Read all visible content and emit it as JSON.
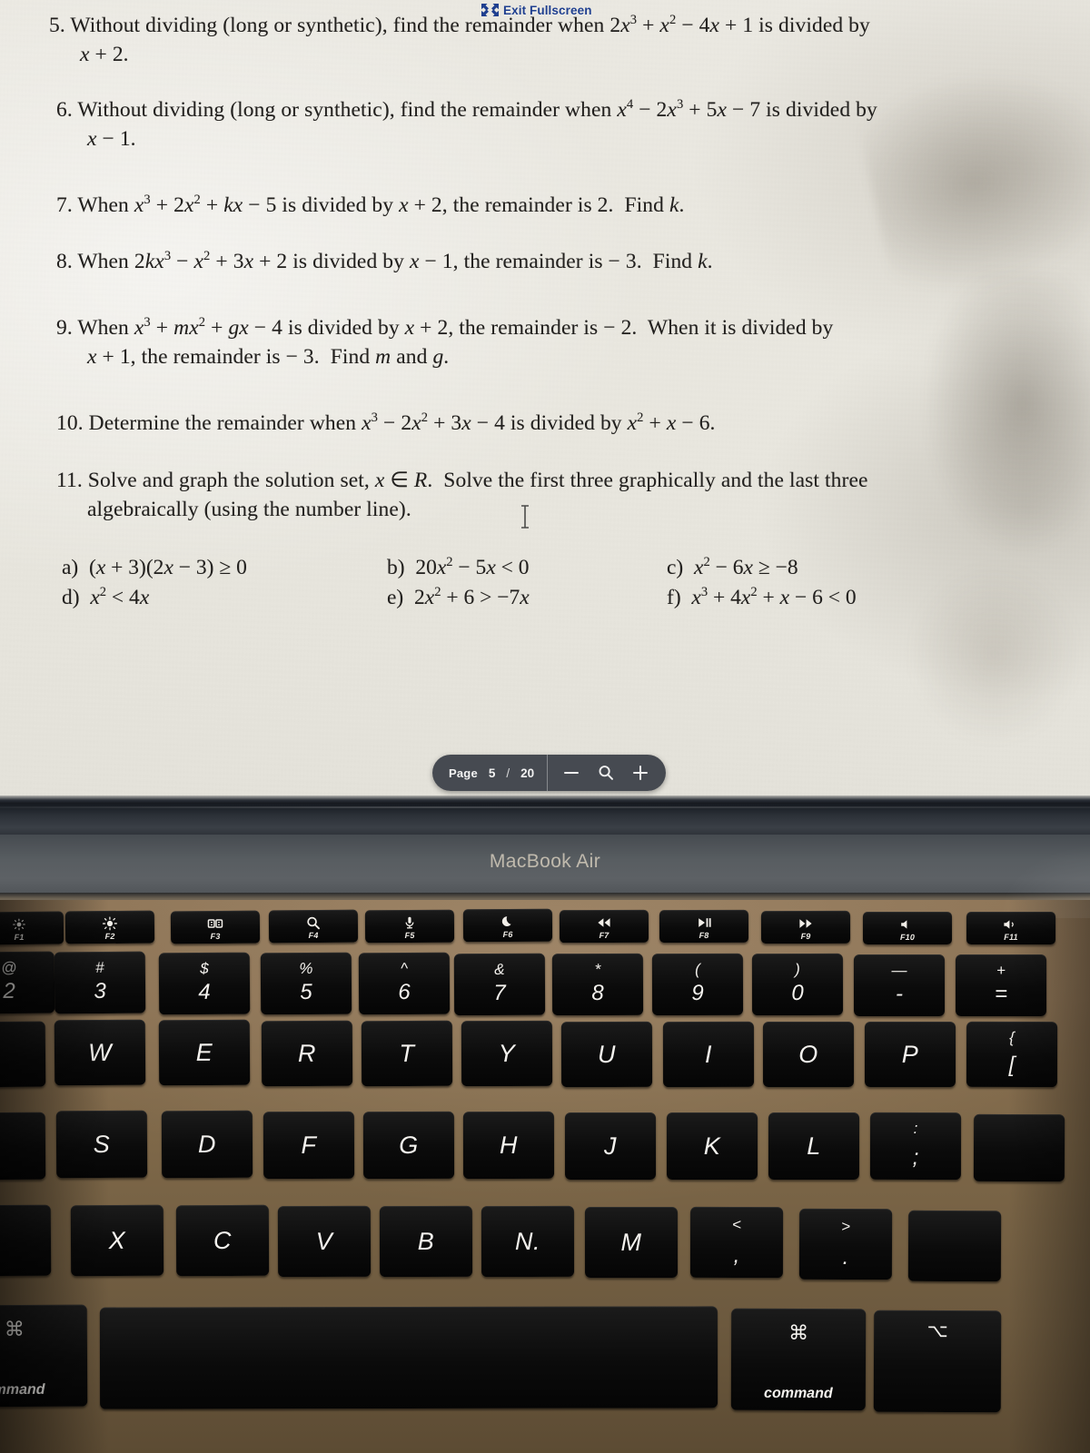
{
  "document": {
    "problems": [
      {
        "id": "p5",
        "number": "5.",
        "line1_pre": "Without dividing (long or synthetic), find the remainder when ",
        "expr1": "2x³ + x² − 4x + 1",
        "line1_post": " is divided by",
        "line2": "x + 2."
      },
      {
        "id": "p6",
        "number": "6.",
        "line1_pre": "Without dividing (long or synthetic), find the remainder when ",
        "expr1": "x⁴ − 2x³ + 5x − 7",
        "line1_post": " is divided by",
        "line2": "x − 1."
      },
      {
        "id": "p7",
        "number": "7.",
        "line1_pre": "When ",
        "expr1": "x³ + 2x² + kx − 5",
        "line1_post": " is divided by x + 2, the remainder is 2.  Find k.",
        "line2": ""
      },
      {
        "id": "p8",
        "number": "8.",
        "line1_pre": "When ",
        "expr1": "2kx³ − x² + 3x + 2",
        "line1_post": " is divided by x − 1, the remainder is − 3.  Find k.",
        "line2": ""
      },
      {
        "id": "p9",
        "number": "9.",
        "line1_pre": "When ",
        "expr1": "x³ + mx² + gx − 4",
        "line1_post": " is divided by x + 2, the remainder is − 2.  When it is divided by",
        "line2": "x + 1, the remainder is − 3.  Find m and g."
      },
      {
        "id": "p10",
        "number": "10.",
        "line1_pre": "Determine the remainder when ",
        "expr1": "x³ − 2x² + 3x − 4",
        "line1_post": " is divided by x² + x − 6.",
        "line2": ""
      },
      {
        "id": "p11",
        "number": "11.",
        "line1_pre": "Solve and graph the solution set, ",
        "expr1": "x ∈ R",
        "line1_post": ".  Solve the first three graphically and the last three",
        "line2": "algebraically (using the number line)."
      }
    ],
    "subproblems": [
      {
        "label": "a)",
        "expr": "(x + 3)(2x − 3) ≥ 0"
      },
      {
        "label": "b)",
        "expr": "20x² − 5x < 0"
      },
      {
        "label": "c)",
        "expr": "x² − 6x ≥ −8"
      },
      {
        "label": "d)",
        "expr": "x² < 4x"
      },
      {
        "label": "e)",
        "expr": "2x² + 6 > −7x"
      },
      {
        "label": "f)",
        "expr": "x³ + 4x² + x − 6 < 0"
      }
    ]
  },
  "overlay": {
    "exit_fullscreen_label": "Exit Fullscreen",
    "exit_fullscreen_icon": "exit-fullscreen-icon",
    "exit_fullscreen_color": "#1f3f8f"
  },
  "pagebar": {
    "page_label": "Page",
    "current_page": "5",
    "separator": "/",
    "total_pages": "20",
    "zoom_out_icon": "minus-icon",
    "zoom_icon": "magnifier-icon",
    "zoom_in_icon": "plus-icon",
    "background": "#3a3e46"
  },
  "laptop": {
    "brand": "MacBook Air",
    "deck_color": "#7d6748",
    "key_color": "#0b0b0b",
    "function_row": [
      {
        "fn": "F1",
        "icon": "brightness-down-icon"
      },
      {
        "fn": "F2",
        "icon": "brightness-up-icon"
      },
      {
        "fn": "F3",
        "icon": "mission-control-icon"
      },
      {
        "fn": "F4",
        "icon": "spotlight-search-icon"
      },
      {
        "fn": "F5",
        "icon": "dictation-mic-icon"
      },
      {
        "fn": "F6",
        "icon": "do-not-disturb-moon-icon"
      },
      {
        "fn": "F7",
        "icon": "rewind-icon"
      },
      {
        "fn": "F8",
        "icon": "play-pause-icon"
      },
      {
        "fn": "F9",
        "icon": "fast-forward-icon"
      },
      {
        "fn": "F10",
        "icon": "mute-icon"
      },
      {
        "fn": "F11",
        "icon": "volume-down-icon"
      }
    ],
    "number_row": [
      {
        "top": "@",
        "bottom": "2"
      },
      {
        "top": "#",
        "bottom": "3"
      },
      {
        "top": "$",
        "bottom": "4"
      },
      {
        "top": "%",
        "bottom": "5"
      },
      {
        "top": "^",
        "bottom": "6"
      },
      {
        "top": "&",
        "bottom": "7"
      },
      {
        "top": "*",
        "bottom": "8"
      },
      {
        "top": "(",
        "bottom": "9"
      },
      {
        "top": ")",
        "bottom": "0"
      },
      {
        "top": "—",
        "bottom": "-"
      },
      {
        "top": "+",
        "bottom": "="
      }
    ],
    "top_letter_row": [
      "W",
      "E",
      "R",
      "T",
      "Y",
      "U",
      "I",
      "O",
      "P"
    ],
    "top_letter_row_last": {
      "top": "{",
      "bottom": "["
    },
    "home_row": [
      "S",
      "D",
      "F",
      "G",
      "H",
      "J",
      "K",
      "L"
    ],
    "home_row_last": {
      "top": ":",
      "bottom": ";"
    },
    "bottom_row": [
      "X",
      "C",
      "V",
      "B",
      "N.",
      "M"
    ],
    "bottom_row_punct": [
      {
        "top": "<",
        "bottom": ","
      },
      {
        "top": ">",
        "bottom": "."
      }
    ],
    "command_left": {
      "glyph": "⌘",
      "label": "ommand"
    },
    "command_right": {
      "glyph": "⌘",
      "label": "command"
    },
    "option_right": {
      "glyph": "⌥"
    },
    "spacebar": {
      "label": ""
    }
  }
}
